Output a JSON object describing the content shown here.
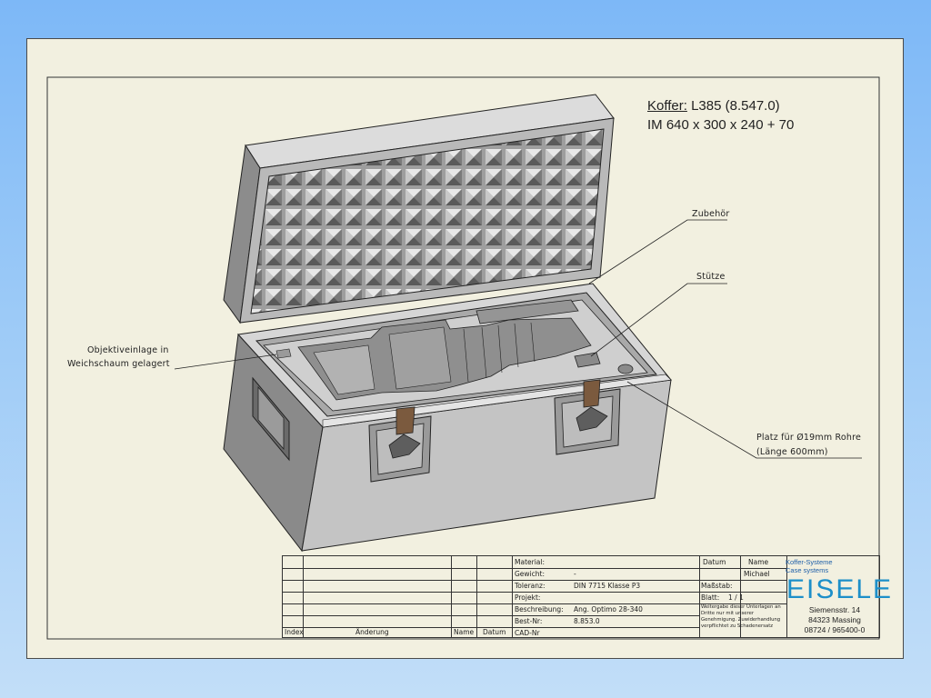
{
  "title": {
    "line1_label": "Koffer:",
    "line1_value": "L385  (8.547.0)",
    "line2": "IM 640 x 300 x 240 + 70"
  },
  "callouts": {
    "zubehoer": "Zubehör",
    "stuetze": "Stütze",
    "objektiv_1": "Objektiveinlage in",
    "objektiv_2": "Weichschaum gelagert",
    "platz_1": "Platz für Ø19mm Rohre",
    "platz_2": "(Länge 600mm)"
  },
  "title_block": {
    "headers": {
      "index": "Index",
      "aenderung": "Änderung",
      "name": "Name",
      "datum": "Datum",
      "datum2": "Datum",
      "name2": "Name"
    },
    "fields": {
      "material_label": "Material:",
      "gewicht_label": "Gewicht:",
      "gewicht_value": "-",
      "toleranz_label": "Toleranz:",
      "toleranz_value": "DIN 7715 Klasse P3",
      "projekt_label": "Projekt:",
      "beschreibung_label": "Beschreibung:",
      "beschreibung_value": "Ang. Optimo 28-340",
      "bestnr_label": "Best-Nr:",
      "bestnr_value": "8.853.0",
      "cadnr_label": "CAD-Nr",
      "name_value": "Michael",
      "massstab_label": "Maßstab:",
      "blatt_label": "Blatt:",
      "blatt_value": "1 / 1",
      "note": "Weitergabe dieser Unterlagen an Dritte nur mit unserer Genehmigung. Zuwiderhandlung verpflichtet zu Schadenersatz"
    },
    "company": {
      "line1": "Koffer-Systeme",
      "line2": "Case systems",
      "name": "EISELE",
      "street": "Siemensstr. 14",
      "city": "84323 Massing",
      "phone": "08724 / 965400-0"
    }
  },
  "colors": {
    "background_top": "#7db8f7",
    "sheet": "#f2f0e0",
    "logo_blue": "#1d8fc9"
  }
}
